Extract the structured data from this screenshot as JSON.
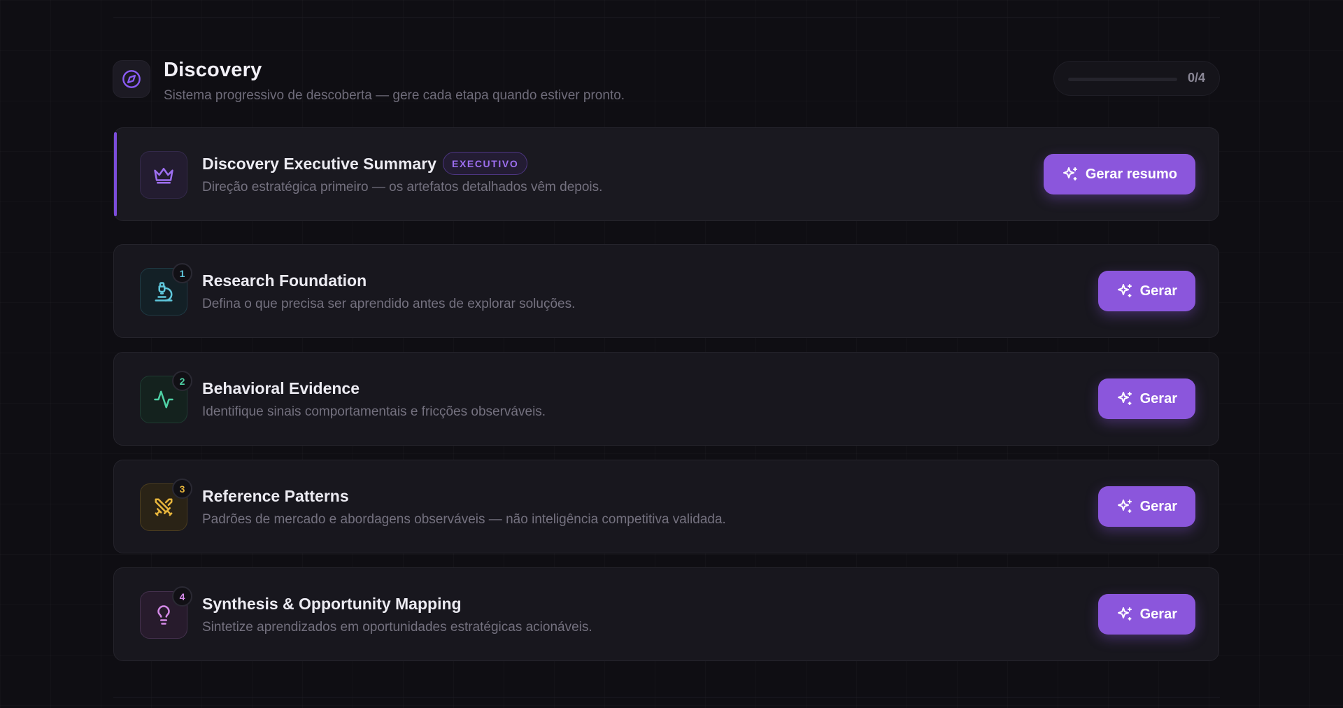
{
  "header": {
    "title": "Discovery",
    "subtitle": "Sistema progressivo de descoberta — gere cada etapa quando estiver pronto.",
    "progress_text": "0/4",
    "progress_fraction": 0
  },
  "executive": {
    "title": "Discovery Executive Summary",
    "tag": "EXECUTIVO",
    "description": "Direção estratégica primeiro — os artefatos detalhados vêm depois.",
    "button": "Gerar resumo",
    "icon": "crown-icon"
  },
  "steps": [
    {
      "number": "1",
      "title": "Research Foundation",
      "description": "Defina o que precisa ser aprendido antes de explorar soluções.",
      "button": "Gerar",
      "icon": "microscope-icon",
      "color": "#5fc7dc"
    },
    {
      "number": "2",
      "title": "Behavioral Evidence",
      "description": "Identifique sinais comportamentais e fricções observáveis.",
      "button": "Gerar",
      "icon": "activity-icon",
      "color": "#4fd1a5"
    },
    {
      "number": "3",
      "title": "Reference Patterns",
      "description": "Padrões de mercado e abordagens observáveis — não inteligência competitiva validada.",
      "button": "Gerar",
      "icon": "swords-icon",
      "color": "#e7b53c"
    },
    {
      "number": "4",
      "title": "Synthesis & Opportunity Mapping",
      "description": "Sintetize aprendizados em oportunidades estratégicas acionáveis.",
      "button": "Gerar",
      "icon": "lightbulb-icon",
      "color": "#d58ae8"
    }
  ],
  "colors": {
    "accent": "#8b56dc",
    "background": "#0f0e13"
  }
}
